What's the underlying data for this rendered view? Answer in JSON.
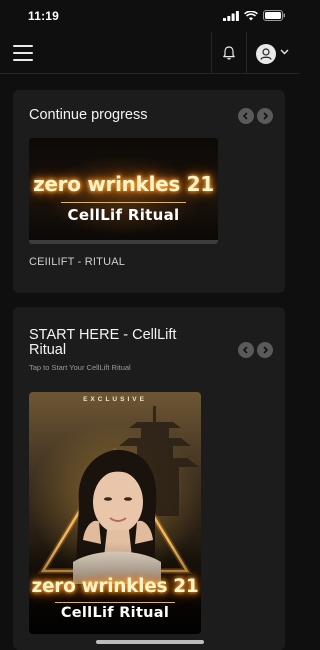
{
  "status_bar": {
    "time": "11:19"
  },
  "header": {
    "menu_icon": "hamburger-menu-icon",
    "notification_icon": "bell-icon",
    "profile_icon": "user-avatar-icon",
    "dropdown_icon": "chevron-down-icon"
  },
  "continue_section": {
    "title": "Continue progress",
    "item": {
      "banner_line1": "zero wrinkles 21",
      "banner_line2": "CellLif Ritual",
      "caption": "CEIILIFT - RITUAL"
    }
  },
  "start_section": {
    "title_line1": "START HERE - CellLift",
    "title_line2": "Ritual",
    "subtitle": "Tap to Start Your CellLift Ritual",
    "item": {
      "badge": "EXCLUSIVE",
      "banner_line1": "zero wrinkles 21",
      "banner_line2": "CellLif Ritual"
    }
  },
  "colors": {
    "background": "#0f0f0f",
    "card": "#1c1c1c",
    "glow": "#ff8c1a",
    "gold": "#d9b46a"
  }
}
